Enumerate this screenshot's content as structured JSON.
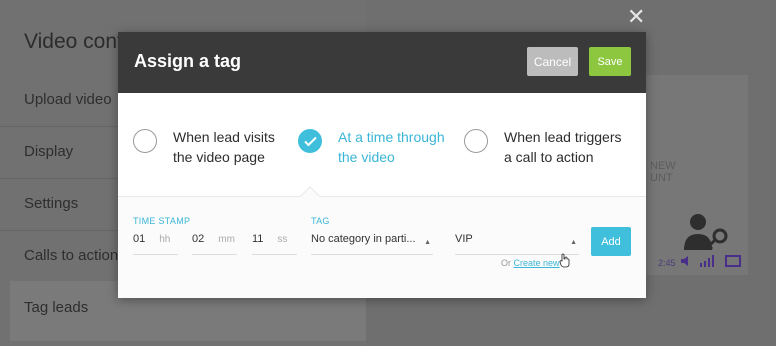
{
  "background": {
    "title": "Video confi",
    "nav_items": [
      "Upload video",
      "Display",
      "Settings",
      "Calls to action",
      "Tag leads"
    ],
    "preview_text_1": "NEW",
    "preview_text_2": "UNT",
    "player_time": "2:45",
    "close_label": "✕"
  },
  "modal": {
    "title": "Assign a tag",
    "cancel_label": "Cancel",
    "save_label": "Save",
    "options": [
      {
        "line1": "When lead visits",
        "line2": "the video page",
        "selected": false
      },
      {
        "line1": "At a time through",
        "line2": "the video",
        "selected": true
      },
      {
        "line1": "When lead triggers",
        "line2": "a call to action",
        "selected": false
      }
    ],
    "timestamp": {
      "label": "TIME STAMP",
      "hours": "01",
      "hours_unit": "hh",
      "minutes": "02",
      "minutes_unit": "mm",
      "seconds": "11",
      "seconds_unit": "ss"
    },
    "tag": {
      "label": "TAG",
      "category": "No category in parti...",
      "value": "VIP"
    },
    "add_label": "Add",
    "create_prefix": "Or",
    "create_link": "Create new"
  },
  "colors": {
    "accent": "#3fbfdc",
    "save_green": "#8dc63f",
    "header_dark": "#3a3a3a"
  }
}
